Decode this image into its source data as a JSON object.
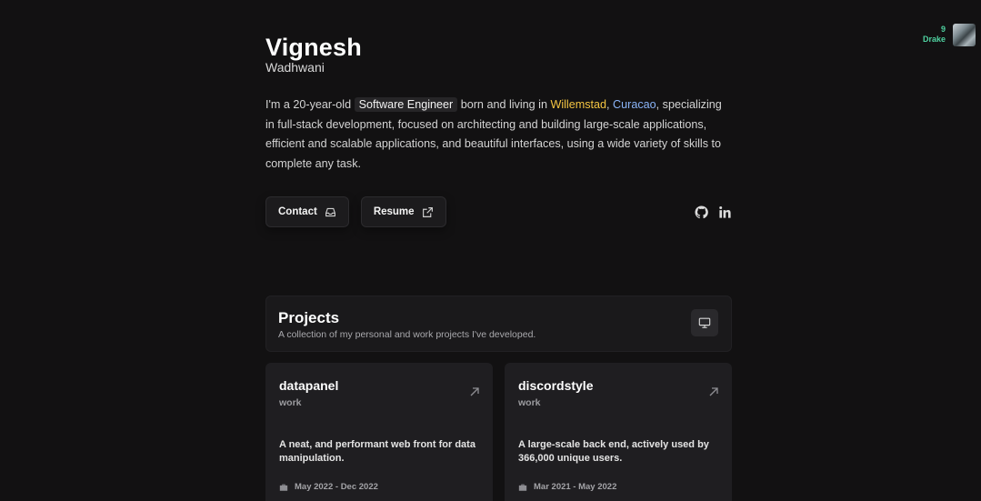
{
  "now_playing": {
    "count": "9",
    "artist": "Drake"
  },
  "header": {
    "first_name": "Vignesh",
    "last_name": "Wadhwani"
  },
  "bio": {
    "p1": "I'm a 20-year-old ",
    "highlight": "Software Engineer",
    "p2": " born and living in ",
    "city": "Willemstad",
    "comma": ", ",
    "country": "Curacao",
    "p3": ", specializing in full-stack development, focused on architecting and building large-scale applications, efficient and scalable applications, and beautiful interfaces, using a wide variety of skills to complete any task."
  },
  "actions": {
    "contact_label": "Contact",
    "resume_label": "Resume"
  },
  "socials": {
    "github_icon": "github-icon",
    "linkedin_icon": "linkedin-icon"
  },
  "projects": {
    "title": "Projects",
    "subtitle": "A collection of my personal and work projects I've developed.",
    "items": [
      {
        "name": "datapanel",
        "tag": "work",
        "description": "A neat, and performant web front for data manipulation.",
        "date": "May 2022 - Dec 2022"
      },
      {
        "name": "discordstyle",
        "tag": "work",
        "description": "A large-scale back end, actively used by 366,000 unique users.",
        "date": "Mar 2021 - May 2022"
      }
    ]
  },
  "colors": {
    "background": "#121112",
    "accent_yellow": "#f4c542",
    "accent_blue": "#8ab4f8",
    "now_playing_green": "#4fd1a0"
  }
}
